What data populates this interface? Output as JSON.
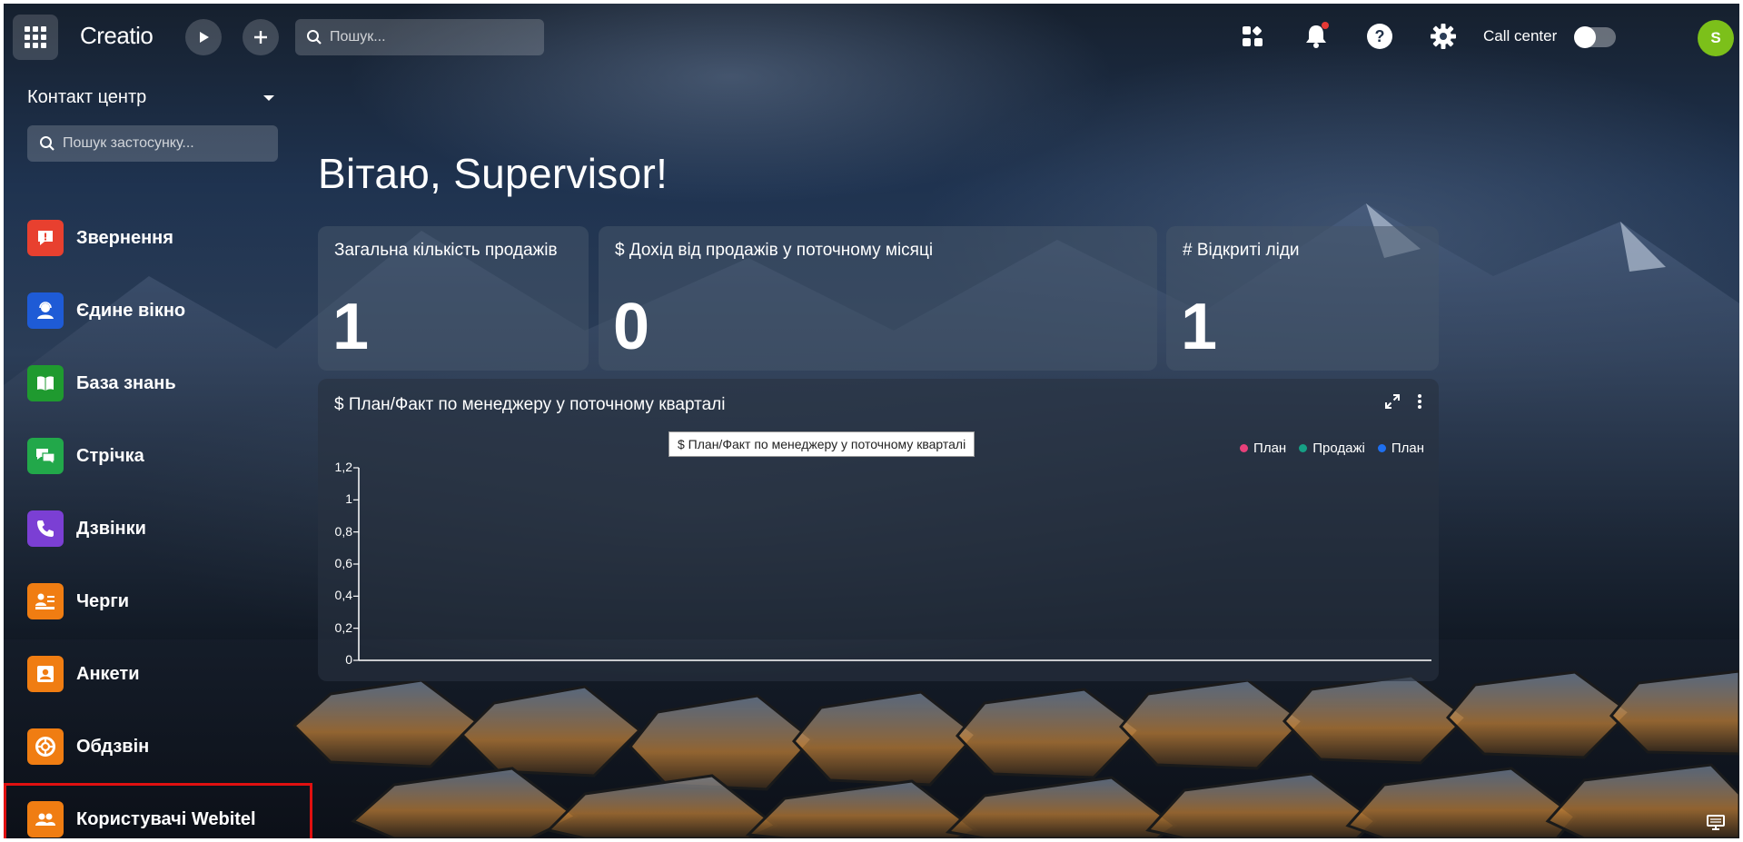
{
  "topbar": {
    "logo": "Creatio",
    "search_placeholder": "Пошук...",
    "call_center_label": "Call center",
    "avatar_initial": "S"
  },
  "sidebar": {
    "workspace": "Контакт центр",
    "app_search_placeholder": "Пошук застосунку...",
    "items": [
      {
        "label": "Звернення",
        "color": "#e8402f"
      },
      {
        "label": "Єдине вікно",
        "color": "#1e5bd6"
      },
      {
        "label": "База знань",
        "color": "#1f9a2f"
      },
      {
        "label": "Стрічка",
        "color": "#22a84a"
      },
      {
        "label": "Дзвінки",
        "color": "#7b3fd4"
      },
      {
        "label": "Черги",
        "color": "#f07d12"
      },
      {
        "label": "Анкети",
        "color": "#f07d12"
      },
      {
        "label": "Обдзвін",
        "color": "#f07d12"
      },
      {
        "label": "Користувачі Webitel",
        "color": "#f07d12"
      }
    ]
  },
  "main": {
    "greeting": "Вітаю, Supervisor!",
    "cards": [
      {
        "title": "Загальна кількість продажів",
        "value": "1"
      },
      {
        "title": "$ Дохід від продажів у поточному місяці",
        "value": "0"
      },
      {
        "title": "# Відкриті ліди",
        "value": "1"
      }
    ]
  },
  "tooltip": "$ План/Факт по менеджеру у поточному кварталі",
  "chart_data": {
    "type": "bar",
    "title": "$ План/Факт по менеджеру у поточному кварталі",
    "series": [
      {
        "name": "План",
        "color": "#e8407a",
        "values": []
      },
      {
        "name": "Продажі",
        "color": "#16a085",
        "values": []
      },
      {
        "name": "План",
        "color": "#1e6ff0",
        "values": []
      }
    ],
    "categories": [],
    "yticks": [
      "0",
      "0,2",
      "0,4",
      "0,6",
      "0,8",
      "1",
      "1,2"
    ],
    "ylim": [
      0,
      1.2
    ],
    "grid": false,
    "legend_position": "top-right"
  }
}
